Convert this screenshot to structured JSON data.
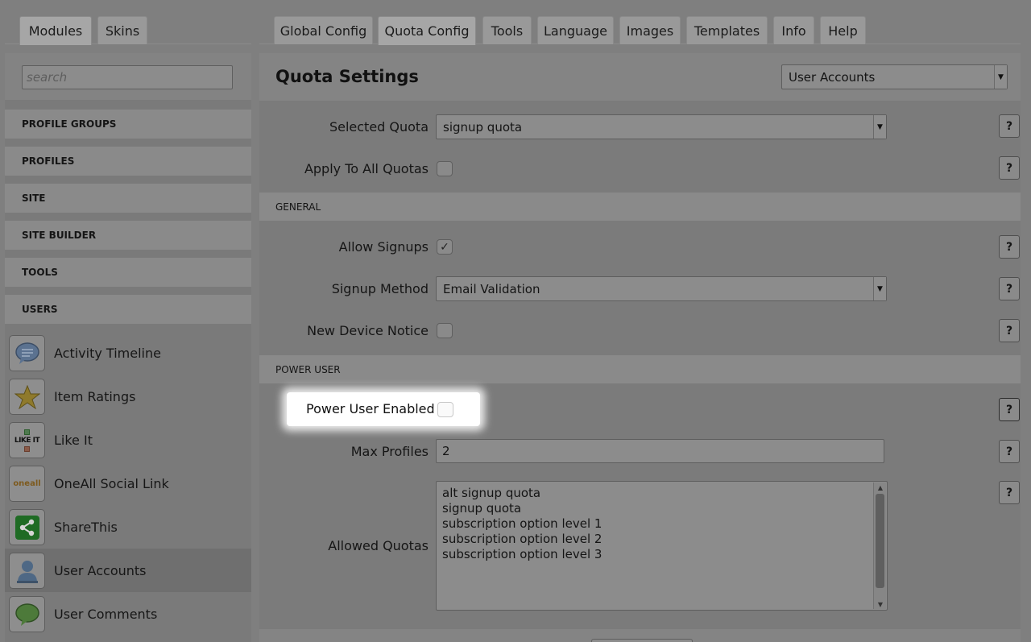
{
  "left_tabs": [
    {
      "label": "Modules",
      "active": true
    },
    {
      "label": "Skins",
      "active": false
    }
  ],
  "right_tabs": [
    {
      "label": "Global Config",
      "active": false
    },
    {
      "label": "Quota Config",
      "active": true
    },
    {
      "label": "Tools",
      "active": false
    },
    {
      "label": "Language",
      "active": false
    },
    {
      "label": "Images",
      "active": false
    },
    {
      "label": "Templates",
      "active": false
    },
    {
      "label": "Info",
      "active": false
    },
    {
      "label": "Help",
      "active": false
    }
  ],
  "sidebar": {
    "search_placeholder": "search",
    "groups": [
      "PROFILE GROUPS",
      "PROFILES",
      "SITE",
      "SITE BUILDER",
      "TOOLS",
      "USERS"
    ],
    "modules": [
      {
        "label": "Activity Timeline",
        "icon": "speech-bubble-icon",
        "selected": false
      },
      {
        "label": "Item Ratings",
        "icon": "star-icon",
        "selected": false
      },
      {
        "label": "Like It",
        "icon": "like-it-icon",
        "icon_text": "LIKE IT",
        "selected": false
      },
      {
        "label": "OneAll Social Link",
        "icon": "oneall-icon",
        "icon_text": "oneall",
        "selected": false
      },
      {
        "label": "ShareThis",
        "icon": "share-icon",
        "selected": false
      },
      {
        "label": "User Accounts",
        "icon": "user-icon",
        "selected": true
      },
      {
        "label": "User Comments",
        "icon": "comment-icon",
        "selected": false
      }
    ]
  },
  "main": {
    "title": "Quota Settings",
    "module_select": "User Accounts",
    "selected_quota_label": "Selected Quota",
    "selected_quota_value": "signup quota",
    "apply_all_label": "Apply To All Quotas",
    "apply_all_checked": false,
    "section_general": "GENERAL",
    "allow_signups_label": "Allow Signups",
    "allow_signups_checked": true,
    "signup_method_label": "Signup Method",
    "signup_method_value": "Email Validation",
    "new_device_label": "New Device Notice",
    "new_device_checked": false,
    "section_power": "POWER USER",
    "power_user_label": "Power User Enabled",
    "power_user_checked": false,
    "max_profiles_label": "Max Profiles",
    "max_profiles_value": "2",
    "allowed_quotas_label": "Allowed Quotas",
    "allowed_quotas": [
      "alt signup quota",
      "signup quota",
      "subscription option level 1",
      "subscription option level 2",
      "subscription option level 3"
    ],
    "help_label": "?"
  },
  "colors": {
    "dim_overlay": "#7f7f7f",
    "spotlight": "#ffffff"
  }
}
